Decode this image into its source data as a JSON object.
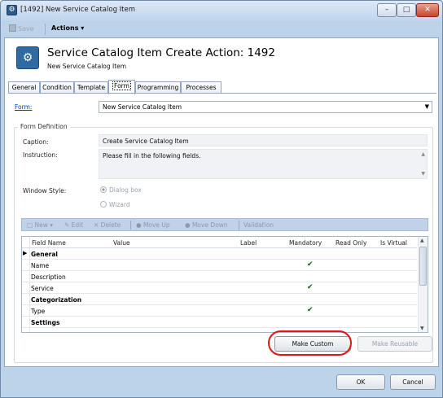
{
  "window": {
    "title": "[1492] New Service Catalog Item",
    "minimize": "–",
    "maximize": "□",
    "close": "✕"
  },
  "toolbar": {
    "save": "Save",
    "actions": "Actions ▾"
  },
  "header": {
    "title": "Service Catalog Item Create Action: 1492",
    "subtitle": "New Service Catalog Item"
  },
  "tabs": [
    "General",
    "Condition",
    "Template",
    "Form",
    "Programming",
    "Processes"
  ],
  "active_tab": "Form",
  "form": {
    "link_label": "Form:",
    "selected": "New Service Catalog Item",
    "definition_legend": "Form Definition",
    "caption_label": "Caption:",
    "caption_value": "Create Service Catalog Item",
    "instruction_label": "Instruction:",
    "instruction_value": "Please fill in the following fields.",
    "window_style_label": "Window Style:",
    "window_style_options": [
      "Dialog box",
      "Wizard"
    ],
    "window_style_selected": "Dialog box"
  },
  "grid_toolbar": {
    "new": "New ▾",
    "edit": "Edit",
    "delete": "Delete",
    "move_up": "Move Up",
    "move_down": "Move Down",
    "validation": "Validation"
  },
  "grid": {
    "columns": [
      "Field Name",
      "Value",
      "Label",
      "Mandatory",
      "Read Only",
      "Is Virtual"
    ],
    "rows": [
      {
        "name": "General",
        "group": true,
        "mandatory": false,
        "current": true
      },
      {
        "name": "Name",
        "group": false,
        "mandatory": true
      },
      {
        "name": "Description",
        "group": false,
        "mandatory": false
      },
      {
        "name": "Service",
        "group": false,
        "mandatory": true
      },
      {
        "name": "Categorization",
        "group": true,
        "mandatory": false
      },
      {
        "name": "Type",
        "group": false,
        "mandatory": true
      },
      {
        "name": "Settings",
        "group": true,
        "mandatory": false
      }
    ]
  },
  "buttons": {
    "make_custom": "Make Custom",
    "make_reusable": "Make Reusable",
    "ok": "OK",
    "cancel": "Cancel"
  },
  "colors": {
    "highlight": "#e01515",
    "link": "#0033cc",
    "checkmark": "#0c5d16"
  }
}
